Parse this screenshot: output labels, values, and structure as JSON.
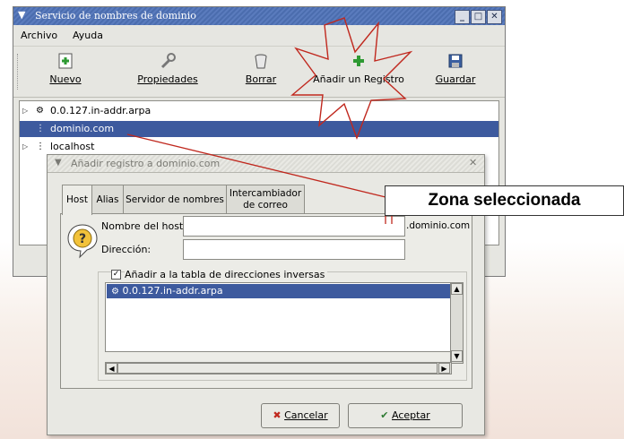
{
  "main": {
    "title": "Servicio de nombres de dominio",
    "menu": [
      {
        "label": "Archivo"
      },
      {
        "label": "Ayuda"
      }
    ],
    "toolbar": [
      {
        "label": "Nuevo",
        "icon": "new-icon"
      },
      {
        "label": "Propiedades",
        "icon": "wrench-icon"
      },
      {
        "label": "Borrar",
        "icon": "trash-icon"
      },
      {
        "label": "Añadir un Registro",
        "icon": "add-icon"
      },
      {
        "label": "Guardar",
        "icon": "floppy-icon"
      }
    ],
    "tree": [
      {
        "label": "0.0.127.in-addr.arpa",
        "expander": "▷"
      },
      {
        "label": "dominio.com",
        "expander": ""
      },
      {
        "label": "localhost",
        "expander": "▷"
      }
    ]
  },
  "dialog": {
    "title": "Añadir registro a  dominio.com",
    "tabs": [
      {
        "label": "Host"
      },
      {
        "label": "Alias"
      },
      {
        "label": "Servidor de nombres"
      },
      {
        "label": "Intercambiador de correo"
      }
    ],
    "hostname_label": "Nombre del host:",
    "hostname_value": "",
    "hostname_suffix": ".dominio.com",
    "address_label": "Dirección:",
    "address_value": "",
    "reverse_label": "Añadir a la tabla de direcciones inversas",
    "reverse_checked": true,
    "reverse_list": [
      "0.0.127.in-addr.arpa"
    ],
    "cancel_label": "Cancelar",
    "ok_label": "Aceptar"
  },
  "annotation": {
    "callout": "Zona seleccionada"
  },
  "colors": {
    "selection": "#3d5a9e",
    "titlebar": "#4b6dae",
    "annotation_line": "#c0281e"
  }
}
